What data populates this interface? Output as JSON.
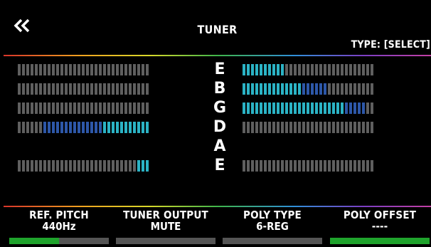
{
  "header": {
    "title": "TUNER",
    "type_label": "TYPE: [SELECT]"
  },
  "colors": {
    "accent_green": "#1fa32c",
    "meter_off": "#5f5f5f",
    "meter_blue": "#2d57a8",
    "meter_cyan": "#2bb3c5"
  },
  "strings": [
    {
      "note": "E",
      "left": {
        "total": 31,
        "blue": 0,
        "cyan": 0,
        "start": 31
      },
      "right": {
        "total": 31,
        "blue": 0,
        "cyan": 10,
        "start": 0
      }
    },
    {
      "note": "B",
      "left": {
        "total": 31,
        "blue": 0,
        "cyan": 0,
        "start": 31
      },
      "right": {
        "total": 31,
        "blue": 6,
        "cyan": 14,
        "start": 0
      }
    },
    {
      "note": "G",
      "left": {
        "total": 31,
        "blue": 0,
        "cyan": 0,
        "start": 31
      },
      "right": {
        "total": 31,
        "blue": 5,
        "cyan": 24,
        "start": 0
      }
    },
    {
      "note": "D",
      "left": {
        "total": 31,
        "blue": 14,
        "cyan": 11,
        "start": 6
      },
      "right": {
        "total": 31,
        "blue": 0,
        "cyan": 0,
        "start": 0
      }
    },
    {
      "note": "A",
      "left": null,
      "right": null
    },
    {
      "note": "E",
      "left": {
        "total": 31,
        "blue": 0,
        "cyan": 3,
        "start": 28
      },
      "right": {
        "total": 31,
        "blue": 0,
        "cyan": 0,
        "start": 0
      }
    }
  ],
  "footer": {
    "params": [
      {
        "label": "REF. PITCH",
        "value": "440Hz",
        "level": 0.5
      },
      {
        "label": "TUNER OUTPUT",
        "value": "MUTE",
        "level": 0
      },
      {
        "label": "POLY TYPE",
        "value": "6-REG",
        "level": 0
      },
      {
        "label": "POLY OFFSET",
        "value": "----",
        "level": 1
      }
    ]
  }
}
